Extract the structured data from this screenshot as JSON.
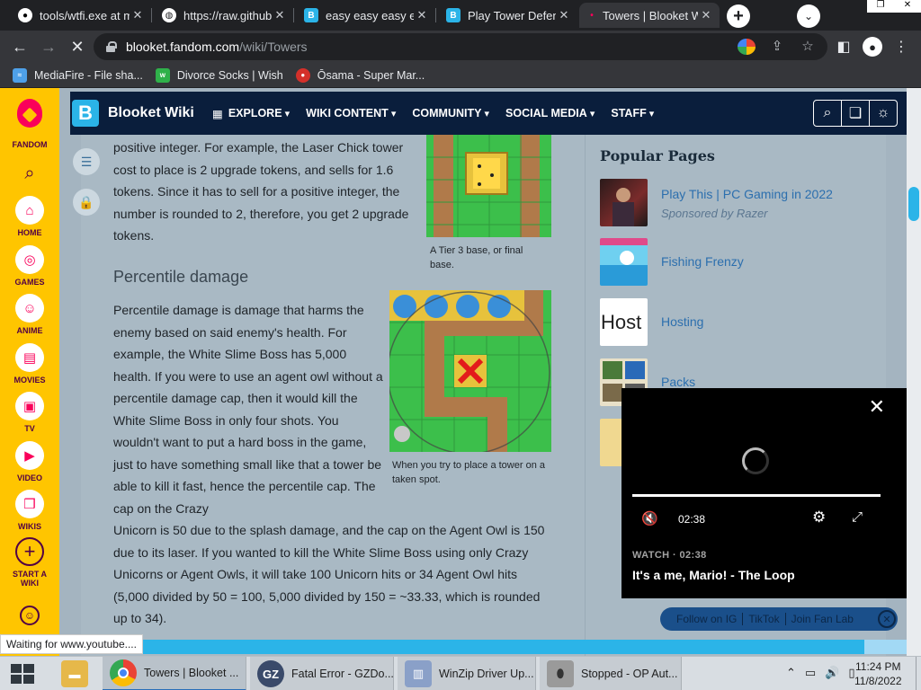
{
  "tabs": [
    {
      "title": "tools/wtfi.exe at m",
      "icon": "github-icon"
    },
    {
      "title": "https://raw.githubu",
      "icon": "globe-icon"
    },
    {
      "title": "easy easy easy ea",
      "icon": "blooket-icon"
    },
    {
      "title": "Play Tower Defen",
      "icon": "blooket-icon"
    },
    {
      "title": "Towers | Blooket W",
      "icon": "fandom-icon"
    }
  ],
  "address": {
    "domain": "blooket.fandom.com",
    "path": "/wiki/Towers"
  },
  "bookmarks": [
    {
      "label": "MediaFire - File sha..."
    },
    {
      "label": "Divorce Socks | Wish"
    },
    {
      "label": "Ōsama - Super Mar..."
    }
  ],
  "fandom_rail": {
    "logo_label": "FANDOM",
    "items": [
      "HOME",
      "GAMES",
      "ANIME",
      "MOVIES",
      "TV",
      "VIDEO",
      "WIKIS"
    ],
    "start_wiki": "START A WIKI"
  },
  "wiki": {
    "name": "Blooket Wiki",
    "logo_letter": "B",
    "nav": [
      "EXPLORE",
      "WIKI CONTENT",
      "COMMUNITY",
      "SOCIAL MEDIA",
      "STAFF"
    ]
  },
  "article": {
    "intro": "positive integer. For example, the Laser Chick tower cost to place is 2 upgrade tokens, and sells for 1.6 tokens. Since it has to sell for a positive integer, the number is rounded to 2, therefore, you get 2 upgrade tokens.",
    "heading": "Percentile damage",
    "para_narrow": "Percentile damage is damage that harms the enemy based on said enemy's health. For example, the White Slime Boss has 5,000 health. If you were to use an agent owl without a percentile damage cap, then it would kill the White Slime Boss in only four shots. You wouldn't want to put a hard boss in the game, just to have something small like that a tower be able to kill it fast, hence the percentile cap. The cap on the Crazy",
    "para_wide": "Unicorn is 50 due to the splash damage, and the cap on the Agent Owl is 150 due to its laser. If you wanted to kill the White Slime Boss using only Crazy Unicorns or Agent Owls, it will take 100 Unicorn hits or 34 Agent Owl hits (5,000 divided by 50 = 100, 5,000 divided by 150 = ~33.33, which is rounded up to 34).",
    "caption1": "A Tier 3 base, or final base.",
    "caption2": "When you try to place a tower on a taken spot."
  },
  "popular": {
    "title": "Popular Pages",
    "items": [
      {
        "label": "Play This | PC Gaming in 2022",
        "sub": "Sponsored by Razer"
      },
      {
        "label": "Fishing Frenzy"
      },
      {
        "label": "Hosting",
        "thumb_text": "Host"
      },
      {
        "label": "Packs"
      }
    ]
  },
  "video": {
    "time": "02:38",
    "watch": "WATCH · 02:38",
    "title": "It's a me, Mario! - The Loop"
  },
  "fanbar": [
    "Follow on IG",
    "TikTok",
    "Join Fan Lab"
  ],
  "status": "Waiting for www.youtube....",
  "taskbar": {
    "apps": [
      {
        "label": "Towers | Blooket ..."
      },
      {
        "label": "Fatal Error - GZDo..."
      },
      {
        "label": "WinZip Driver Up..."
      },
      {
        "label": "Stopped - OP Aut..."
      }
    ],
    "time": "11:24 PM",
    "date": "11/8/2022"
  },
  "colors": {
    "accent": "#2bb4e8",
    "fandom_yellow": "#ffc500",
    "fandom_pink": "#fa005a",
    "header_navy": "#0a1e3c"
  }
}
